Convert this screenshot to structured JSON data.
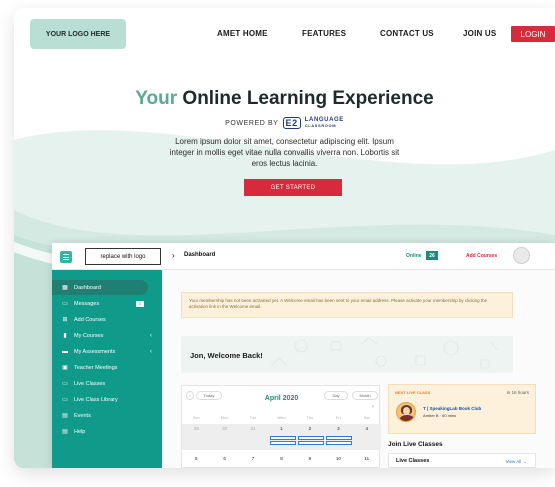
{
  "nav": {
    "logo": "YOUR LOGO HERE",
    "links": [
      "AMET HOME",
      "FEATURES",
      "CONTACT US",
      "JOIN US"
    ],
    "login": "LOGIN"
  },
  "hero": {
    "title_accent": "Your",
    "title_rest": "Online Learning Experience",
    "powered_by": "POWERED BY",
    "brand_badge": "E2",
    "brand_name": "LANGUAGE",
    "brand_sub": "CLASSROOM",
    "lead": "Lorem ipsum dolor sit amet, consectetur adipiscing elit. Ipsum integer in mollis eget vitae nulla convallis viverra non. Lobortis sit eros lectus lacinia.",
    "cta": "GET STARTED"
  },
  "app": {
    "logo_placeholder": "replace with logo",
    "crumb": "Dashboard",
    "online_label": "Online",
    "online_count": "26",
    "add_courses": "Add Courses",
    "sidebar": [
      {
        "label": "Dashboard",
        "icon": "grid-icon"
      },
      {
        "label": "Messages",
        "icon": "message-icon",
        "badge": "2"
      },
      {
        "label": "Add Courses",
        "icon": "add-courses-icon"
      },
      {
        "label": "My Courses",
        "icon": "book-icon"
      },
      {
        "label": "My Assessments",
        "icon": "assessment-icon"
      },
      {
        "label": "Teacher Meetings",
        "icon": "calendar-icon"
      },
      {
        "label": "Live Classes",
        "icon": "monitor-icon"
      },
      {
        "label": "Live Class Library",
        "icon": "library-icon"
      },
      {
        "label": "Events",
        "icon": "events-icon"
      },
      {
        "label": "Help",
        "icon": "help-icon"
      }
    ],
    "notice": "Your membership has not been activated yet. A Welcome email has been sent to your email address. Please activate your membership by clicking the activation link in the Welcome email.",
    "welcome": "Jon, Welcome Back!",
    "calendar": {
      "today": "Today",
      "month": "April 2020",
      "day_btn": "Day",
      "month_btn": "Month",
      "weekdays": [
        "Sun",
        "Mon",
        "Tue",
        "Wed",
        "Thu",
        "Fri",
        "Sat"
      ],
      "row1": [
        "29",
        "30",
        "31",
        "1",
        "2",
        "3",
        "4"
      ],
      "row2": [
        "5",
        "6",
        "7",
        "8",
        "9",
        "10",
        "11"
      ]
    },
    "next_live": {
      "tag": "NEXT LIVE CLASS",
      "time": "in 16 hours",
      "title": "T | SpeakingLab Book Club",
      "sub": "Amber B · 60 mins"
    },
    "join_title": "Join Live Classes",
    "live_classes": "Live Classes",
    "view_all": "View All →"
  }
}
